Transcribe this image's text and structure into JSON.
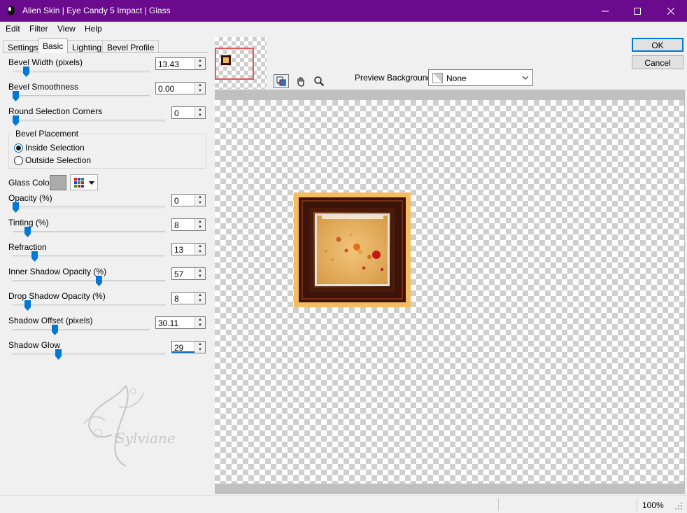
{
  "window": {
    "title": "Alien Skin | Eye Candy 5 Impact | Glass"
  },
  "menu": [
    "Edit",
    "Filter",
    "View",
    "Help"
  ],
  "tabs": [
    "Settings",
    "Basic",
    "Lighting",
    "Bevel Profile"
  ],
  "active_tab": "Basic",
  "params": {
    "bevel_width": {
      "label": "Bevel Width (pixels)",
      "value": "13.43",
      "level": 0.08
    },
    "bevel_smoothness": {
      "label": "Bevel Smoothness",
      "value": "0.00",
      "level": 0.0
    },
    "round_corners": {
      "label": "Round Selection Corners",
      "value": "0",
      "level": 0.0
    },
    "opacity": {
      "label": "Opacity (%)",
      "value": "0",
      "level": 0.0
    },
    "tinting": {
      "label": "Tinting (%)",
      "value": "8",
      "level": 0.08
    },
    "refraction": {
      "label": "Refraction",
      "value": "13",
      "level": 0.13
    },
    "inner_shadow": {
      "label": "Inner Shadow Opacity (%)",
      "value": "57",
      "level": 0.57
    },
    "drop_shadow": {
      "label": "Drop Shadow Opacity (%)",
      "value": "8",
      "level": 0.08
    },
    "shadow_offset": {
      "label": "Shadow Offset (pixels)",
      "value": "30.11",
      "level": 0.3
    },
    "shadow_glow": {
      "label": "Shadow Glow",
      "value": "29",
      "level": 0.29
    }
  },
  "placement": {
    "title": "Bevel Placement",
    "inside": "Inside Selection",
    "outside": "Outside Selection",
    "selected": "inside"
  },
  "glass_color": {
    "label": "Glass Color",
    "color": "#ababab"
  },
  "buttons": {
    "ok": "OK",
    "cancel": "Cancel"
  },
  "preview_background": {
    "label": "Preview Background:",
    "value": "None"
  },
  "watermark": "Sylviane",
  "status": {
    "zoom": "100%"
  },
  "colors": {
    "titlebar": "#6a0a8c",
    "accent": "#0078d7"
  }
}
